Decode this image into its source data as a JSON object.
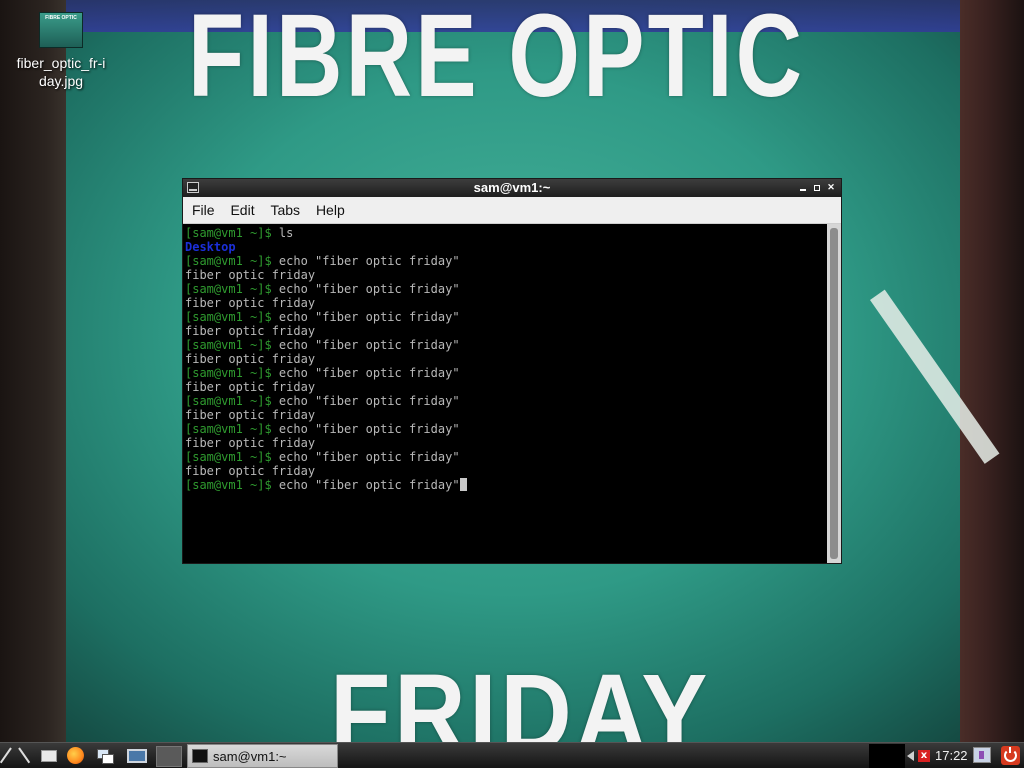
{
  "desktop": {
    "wallpaper_overlay_top": "FIBRE OPTIC",
    "wallpaper_overlay_bottom": "FRIDAY",
    "icons": [
      {
        "label": "fiber_optic_fr-iday.jpg",
        "thumb_text": "FIBRE OPTIC"
      }
    ]
  },
  "terminal": {
    "title": "sam@vm1:~",
    "menu": [
      "File",
      "Edit",
      "Tabs",
      "Help"
    ],
    "prompt": "[sam@vm1 ~]$",
    "lines": [
      {
        "type": "cmd",
        "text": "ls"
      },
      {
        "type": "dir",
        "text": "Desktop"
      },
      {
        "type": "cmd",
        "text": "echo \"fiber optic friday\""
      },
      {
        "type": "out",
        "text": "fiber optic friday"
      },
      {
        "type": "cmd",
        "text": "echo \"fiber optic friday\""
      },
      {
        "type": "out",
        "text": "fiber optic friday"
      },
      {
        "type": "cmd",
        "text": "echo \"fiber optic friday\""
      },
      {
        "type": "out",
        "text": "fiber optic friday"
      },
      {
        "type": "cmd",
        "text": "echo \"fiber optic friday\""
      },
      {
        "type": "out",
        "text": "fiber optic friday"
      },
      {
        "type": "cmd",
        "text": "echo \"fiber optic friday\""
      },
      {
        "type": "out",
        "text": "fiber optic friday"
      },
      {
        "type": "cmd",
        "text": "echo \"fiber optic friday\""
      },
      {
        "type": "out",
        "text": "fiber optic friday"
      },
      {
        "type": "cmd",
        "text": "echo \"fiber optic friday\""
      },
      {
        "type": "out",
        "text": "fiber optic friday"
      },
      {
        "type": "cmd",
        "text": "echo \"fiber optic friday\""
      },
      {
        "type": "out",
        "text": "fiber optic friday"
      },
      {
        "type": "cmd_current",
        "text": "echo \"fiber optic friday\""
      }
    ],
    "colors": {
      "prompt": "#2f9b2f",
      "directory": "#1b2fd8",
      "text": "#b8b8b8",
      "background": "#000000"
    }
  },
  "taskbar": {
    "launchers": [
      {
        "name": "start-menu",
        "icon": "lxde-logo-icon"
      },
      {
        "name": "file-manager",
        "icon": "folder-icon"
      },
      {
        "name": "web-browser",
        "icon": "firefox-icon"
      },
      {
        "name": "window-switcher",
        "icon": "windows-icon"
      },
      {
        "name": "show-desktop",
        "icon": "desktop-icon"
      }
    ],
    "tasks": [
      {
        "label": "sam@vm1:~",
        "icon": "terminal-icon"
      }
    ],
    "clock": "17:22",
    "tray_network_status": "x",
    "tray_icons": [
      "network-disconnected-icon",
      "screen-icon",
      "power-icon"
    ]
  }
}
